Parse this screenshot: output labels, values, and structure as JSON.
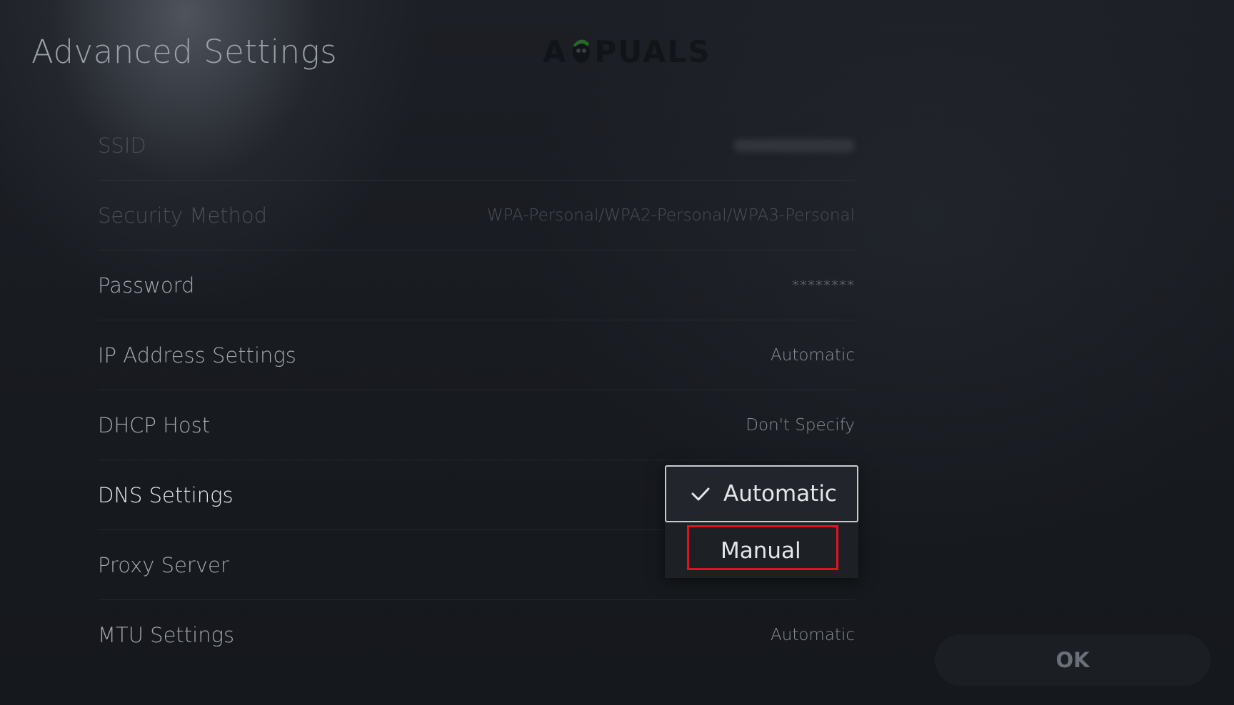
{
  "header": {
    "title": "Advanced Settings",
    "watermark": "A PUALS"
  },
  "settings": [
    {
      "label": "SSID",
      "value": ""
    },
    {
      "label": "Security Method",
      "value": "WPA-Personal/WPA2-Personal/WPA3-Personal"
    },
    {
      "label": "Password",
      "value": "********"
    },
    {
      "label": "IP Address Settings",
      "value": "Automatic"
    },
    {
      "label": "DHCP Host",
      "value": "Don't Specify"
    },
    {
      "label": "DNS Settings",
      "value": ""
    },
    {
      "label": "Proxy Server",
      "value": ""
    },
    {
      "label": "MTU Settings",
      "value": "Automatic"
    }
  ],
  "dns_dropdown": {
    "options": [
      {
        "label": "Automatic",
        "selected": true,
        "icon": "check-icon"
      },
      {
        "label": "Manual",
        "selected": false,
        "highlighted": true
      }
    ]
  },
  "footer": {
    "ok_label": "OK"
  },
  "colors": {
    "highlight": "#e0141e",
    "background": "#181b20"
  }
}
